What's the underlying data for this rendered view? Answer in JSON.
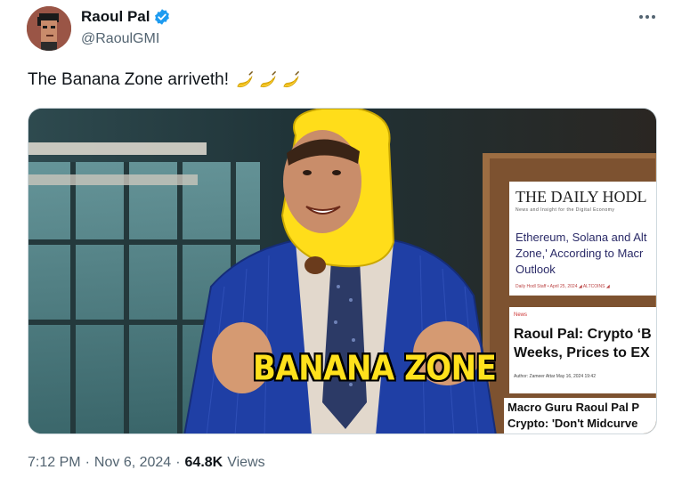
{
  "author": {
    "display_name": "Raoul Pal",
    "handle": "@RaoulGMI",
    "verified": true,
    "avatar_icon": "pixel-punk-avatar"
  },
  "tweet": {
    "text": "The Banana Zone arriveth!",
    "emojis": [
      "banana-emoji",
      "banana-emoji",
      "banana-emoji"
    ]
  },
  "media": {
    "caption": "BANANA ZONE",
    "articles": [
      {
        "outlet": "THE DAILY HODL",
        "tagline": "News and Insight for the Digital Economy",
        "headline_lines": [
          "Ethereum, Solana and Alt",
          "Zone,' According to Macr",
          "Outlook"
        ],
        "meta": "Daily Hodl Staff  •  April 25, 2024  ◢ ALTCOINS ◢"
      },
      {
        "section": "News",
        "headline_lines": [
          "Raoul Pal: Crypto ‘B",
          "Weeks, Prices to EX"
        ],
        "meta": "Author: Zameer Attar   May 16, 2024 19:42"
      },
      {
        "headline_lines": [
          "Macro Guru Raoul Pal P",
          "Crypto: 'Don't Midcurve"
        ]
      }
    ]
  },
  "footer": {
    "time": "7:12 PM",
    "separator": "·",
    "date": "Nov 6, 2024",
    "views_count": "64.8K",
    "views_label": "Views"
  },
  "colors": {
    "text_primary": "#0f1419",
    "text_secondary": "#536471",
    "verified_blue": "#1d9bf0",
    "caption_yellow": "#ffe11c"
  }
}
